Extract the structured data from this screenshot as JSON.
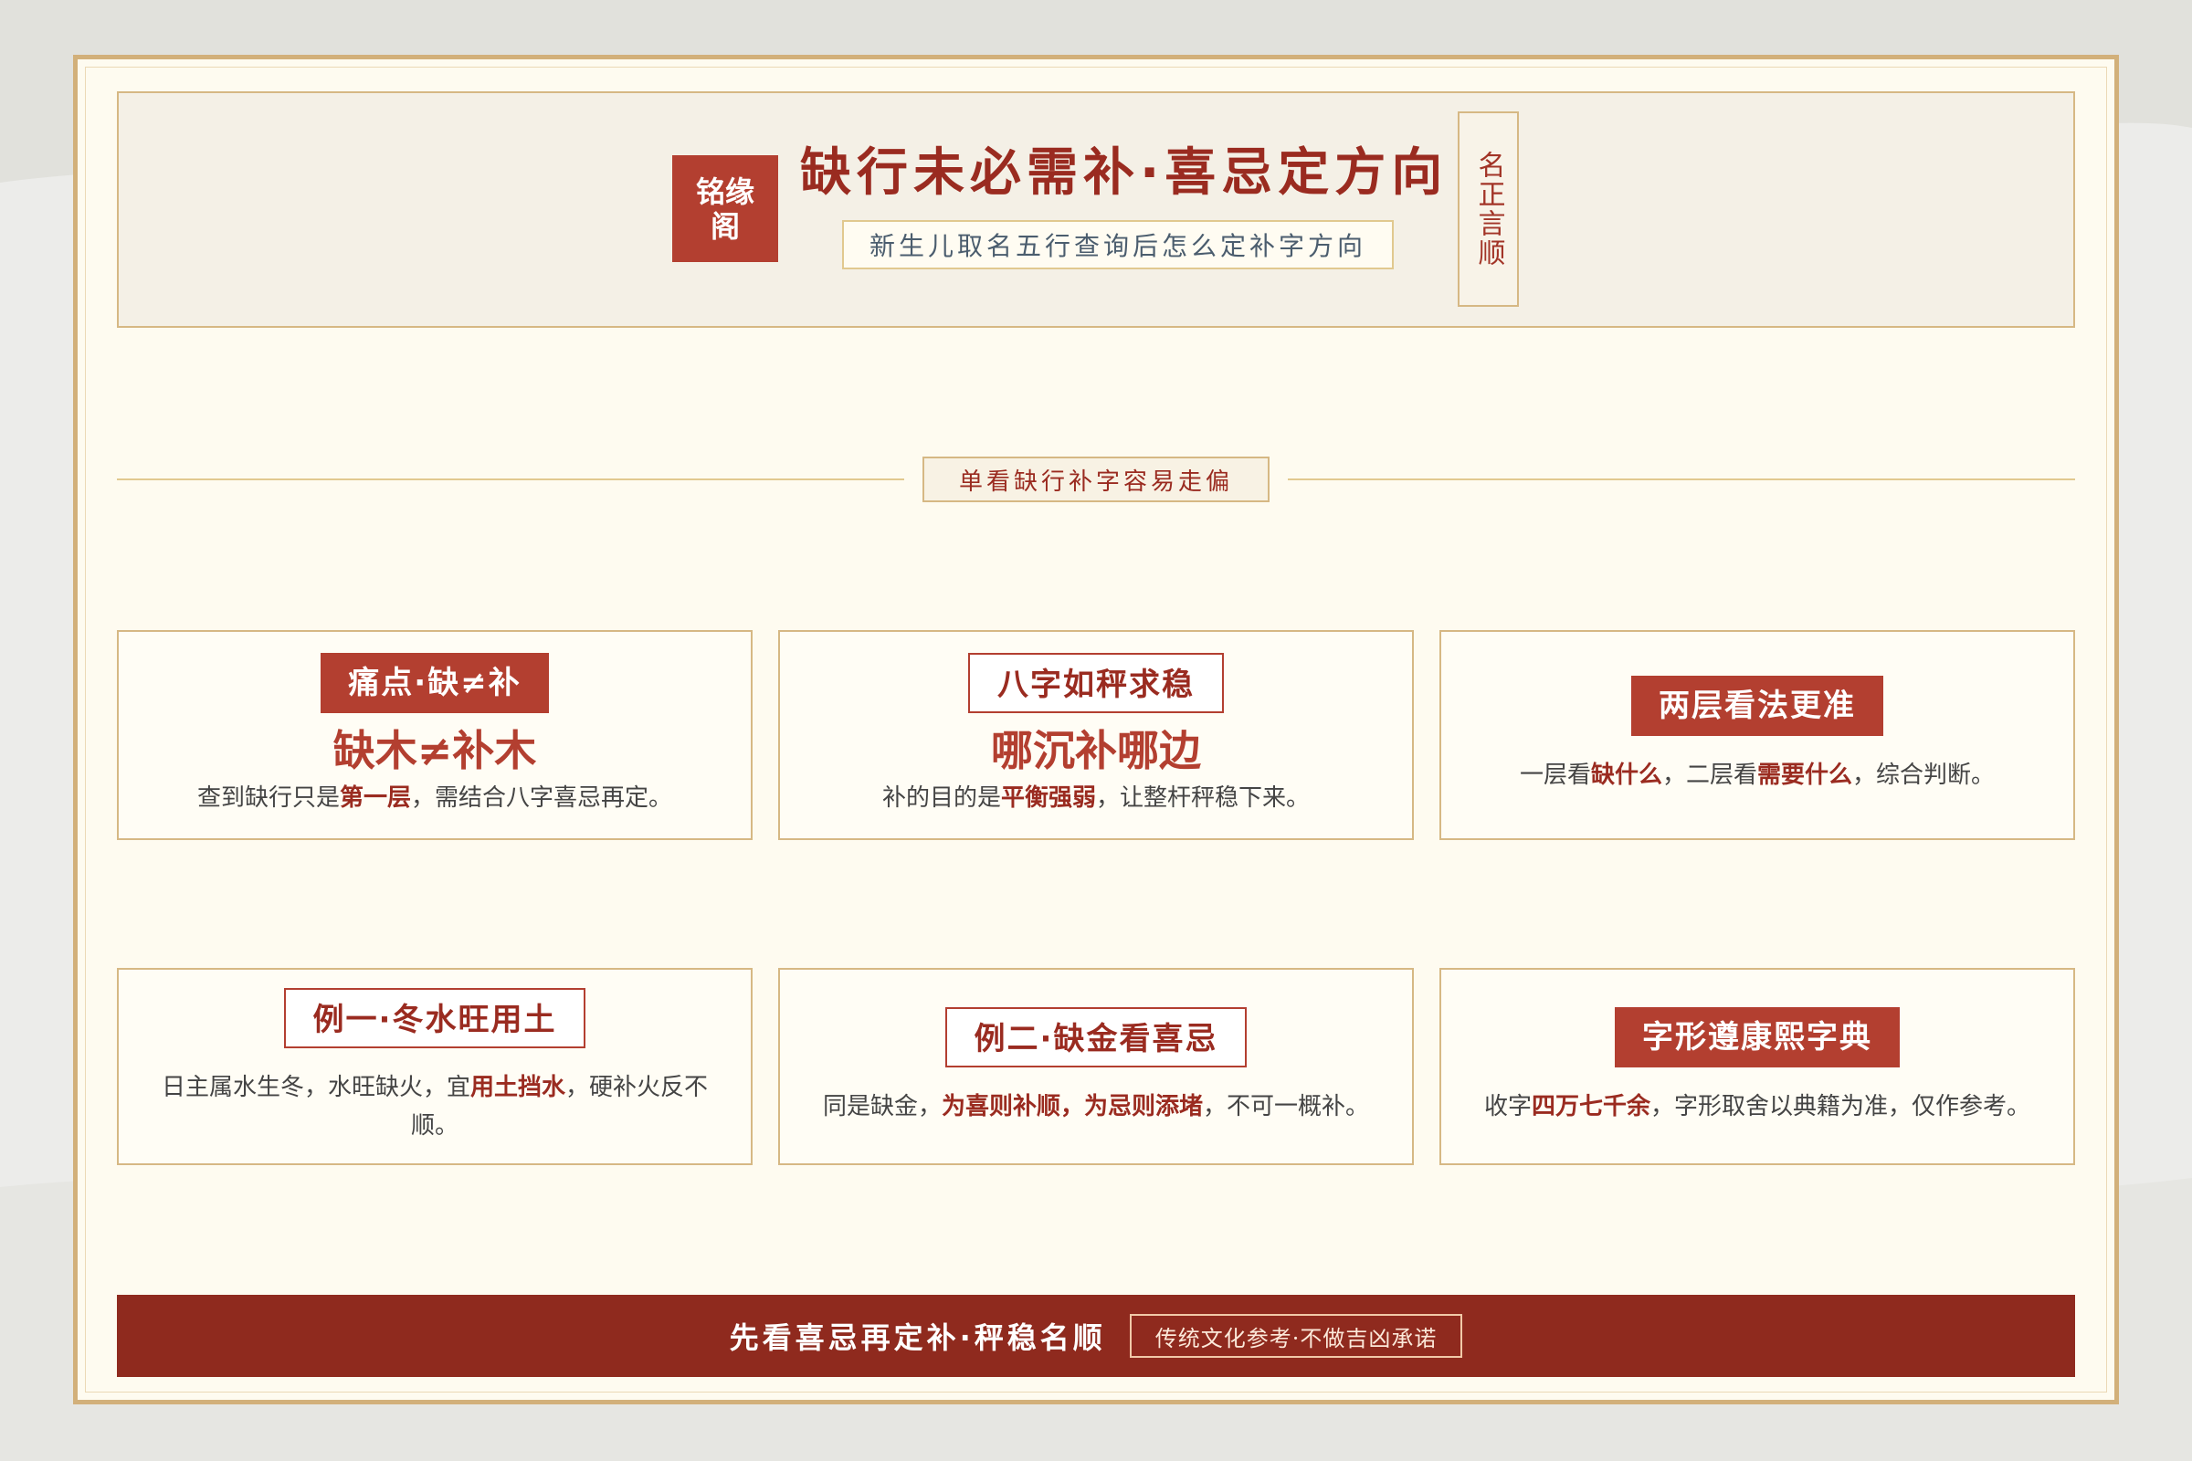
{
  "colors": {
    "accent": "#b33f30",
    "deep_red": "#8f2a1e",
    "gold": "#d6b884",
    "paper": "#fefbf0"
  },
  "header": {
    "logo": "铭缘阁",
    "title": "缺行未必需补·喜忌定方向",
    "subtitle": "新生儿取名五行查询后怎么定补字方向",
    "seal": "名正言顺"
  },
  "section": {
    "label": "单看缺行补字容易走偏"
  },
  "cards": [
    {
      "tag": "痛点·缺≠补",
      "tag_style": "solid",
      "title": "缺木≠补木",
      "desc": [
        {
          "text": "查到缺行只是",
          "bold": false
        },
        {
          "text": "第一层",
          "bold": true
        },
        {
          "text": "，需结合八字喜忌再定。",
          "bold": false
        }
      ]
    },
    {
      "tag": "八字如秤求稳",
      "tag_style": "outline",
      "title": "哪沉补哪边",
      "desc": [
        {
          "text": "补的目的是",
          "bold": false
        },
        {
          "text": "平衡强弱",
          "bold": true
        },
        {
          "text": "，让整杆秤稳下来。",
          "bold": false
        }
      ]
    },
    {
      "tag": "两层看法更准",
      "tag_style": "solid",
      "title": "",
      "desc": [
        {
          "text": "一层看",
          "bold": false
        },
        {
          "text": "缺什么",
          "bold": true
        },
        {
          "text": "，二层看",
          "bold": false
        },
        {
          "text": "需要什么",
          "bold": true
        },
        {
          "text": "，综合判断。",
          "bold": false
        }
      ]
    },
    {
      "tag": "例一·冬水旺用土",
      "tag_style": "outline",
      "title": "",
      "desc": [
        {
          "text": "日主属水生冬，水旺缺火，宜",
          "bold": false
        },
        {
          "text": "用土挡水",
          "bold": true
        },
        {
          "text": "，硬补火反不顺。",
          "bold": false
        }
      ]
    },
    {
      "tag": "例二·缺金看喜忌",
      "tag_style": "outline",
      "title": "",
      "desc": [
        {
          "text": "同是缺金，",
          "bold": false
        },
        {
          "text": "为喜则补顺，为忌则添堵",
          "bold": true
        },
        {
          "text": "，不可一概补。",
          "bold": false
        }
      ]
    },
    {
      "tag": "字形遵康熙字典",
      "tag_style": "solid",
      "title": "",
      "desc": [
        {
          "text": "收字",
          "bold": false
        },
        {
          "text": "四万七千余",
          "bold": true
        },
        {
          "text": "，字形取舍以典籍为准，仅作参考。",
          "bold": false
        }
      ]
    }
  ],
  "footer": {
    "main": "先看喜忌再定补·秤稳名顺",
    "note": "传统文化参考·不做吉凶承诺"
  }
}
